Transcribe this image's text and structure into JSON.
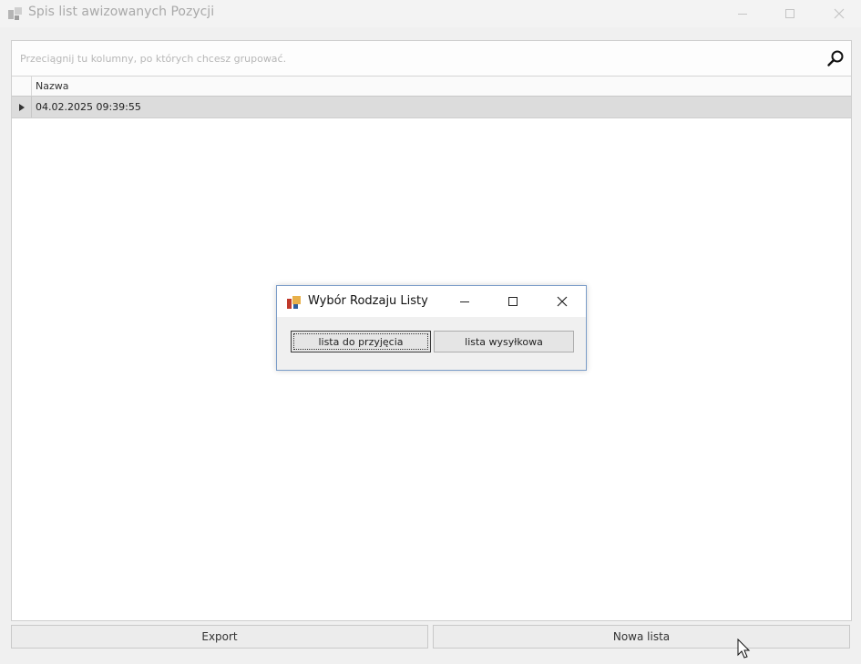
{
  "main_window": {
    "title": "Spis list awizowanych Pozycji"
  },
  "grid": {
    "group_hint": "Przeciągnij tu kolumny, po których chcesz grupować.",
    "columns": [
      "Nazwa"
    ],
    "rows": [
      {
        "nazwa": "04.02.2025 09:39:55"
      }
    ]
  },
  "buttons": {
    "export": "Export",
    "nowa_lista": "Nowa lista"
  },
  "dialog": {
    "title": "Wybór Rodzaju Listy",
    "btn_przyjecia": "lista do przyjęcia",
    "btn_wysylkowa": "lista wysyłkowa"
  },
  "icons": {
    "app": "app-logo-icon",
    "search": "search-icon",
    "minimize": "minimize-icon",
    "maximize": "maximize-icon",
    "close": "close-icon",
    "row_indicator": "row-indicator-triangle-icon"
  },
  "colors": {
    "dialog_border": "#7a9cc8",
    "selected_row": "#dcdcdc"
  }
}
